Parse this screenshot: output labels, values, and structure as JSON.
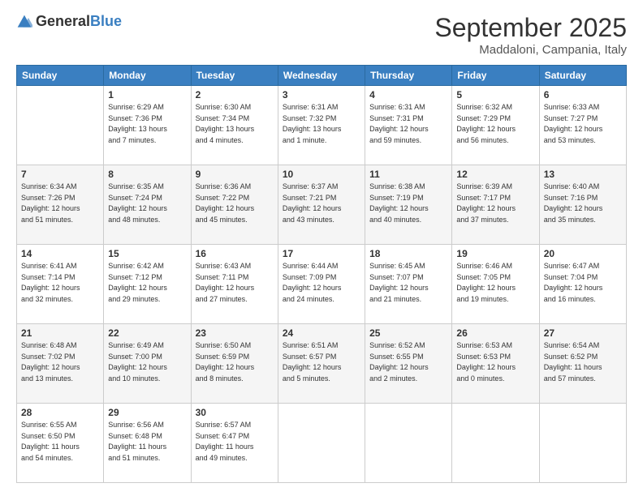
{
  "logo": {
    "general": "General",
    "blue": "Blue"
  },
  "header": {
    "month": "September 2025",
    "location": "Maddaloni, Campania, Italy"
  },
  "weekdays": [
    "Sunday",
    "Monday",
    "Tuesday",
    "Wednesday",
    "Thursday",
    "Friday",
    "Saturday"
  ],
  "weeks": [
    [
      {
        "day": "",
        "info": ""
      },
      {
        "day": "1",
        "info": "Sunrise: 6:29 AM\nSunset: 7:36 PM\nDaylight: 13 hours\nand 7 minutes."
      },
      {
        "day": "2",
        "info": "Sunrise: 6:30 AM\nSunset: 7:34 PM\nDaylight: 13 hours\nand 4 minutes."
      },
      {
        "day": "3",
        "info": "Sunrise: 6:31 AM\nSunset: 7:32 PM\nDaylight: 13 hours\nand 1 minute."
      },
      {
        "day": "4",
        "info": "Sunrise: 6:31 AM\nSunset: 7:31 PM\nDaylight: 12 hours\nand 59 minutes."
      },
      {
        "day": "5",
        "info": "Sunrise: 6:32 AM\nSunset: 7:29 PM\nDaylight: 12 hours\nand 56 minutes."
      },
      {
        "day": "6",
        "info": "Sunrise: 6:33 AM\nSunset: 7:27 PM\nDaylight: 12 hours\nand 53 minutes."
      }
    ],
    [
      {
        "day": "7",
        "info": "Sunrise: 6:34 AM\nSunset: 7:26 PM\nDaylight: 12 hours\nand 51 minutes."
      },
      {
        "day": "8",
        "info": "Sunrise: 6:35 AM\nSunset: 7:24 PM\nDaylight: 12 hours\nand 48 minutes."
      },
      {
        "day": "9",
        "info": "Sunrise: 6:36 AM\nSunset: 7:22 PM\nDaylight: 12 hours\nand 45 minutes."
      },
      {
        "day": "10",
        "info": "Sunrise: 6:37 AM\nSunset: 7:21 PM\nDaylight: 12 hours\nand 43 minutes."
      },
      {
        "day": "11",
        "info": "Sunrise: 6:38 AM\nSunset: 7:19 PM\nDaylight: 12 hours\nand 40 minutes."
      },
      {
        "day": "12",
        "info": "Sunrise: 6:39 AM\nSunset: 7:17 PM\nDaylight: 12 hours\nand 37 minutes."
      },
      {
        "day": "13",
        "info": "Sunrise: 6:40 AM\nSunset: 7:16 PM\nDaylight: 12 hours\nand 35 minutes."
      }
    ],
    [
      {
        "day": "14",
        "info": "Sunrise: 6:41 AM\nSunset: 7:14 PM\nDaylight: 12 hours\nand 32 minutes."
      },
      {
        "day": "15",
        "info": "Sunrise: 6:42 AM\nSunset: 7:12 PM\nDaylight: 12 hours\nand 29 minutes."
      },
      {
        "day": "16",
        "info": "Sunrise: 6:43 AM\nSunset: 7:11 PM\nDaylight: 12 hours\nand 27 minutes."
      },
      {
        "day": "17",
        "info": "Sunrise: 6:44 AM\nSunset: 7:09 PM\nDaylight: 12 hours\nand 24 minutes."
      },
      {
        "day": "18",
        "info": "Sunrise: 6:45 AM\nSunset: 7:07 PM\nDaylight: 12 hours\nand 21 minutes."
      },
      {
        "day": "19",
        "info": "Sunrise: 6:46 AM\nSunset: 7:05 PM\nDaylight: 12 hours\nand 19 minutes."
      },
      {
        "day": "20",
        "info": "Sunrise: 6:47 AM\nSunset: 7:04 PM\nDaylight: 12 hours\nand 16 minutes."
      }
    ],
    [
      {
        "day": "21",
        "info": "Sunrise: 6:48 AM\nSunset: 7:02 PM\nDaylight: 12 hours\nand 13 minutes."
      },
      {
        "day": "22",
        "info": "Sunrise: 6:49 AM\nSunset: 7:00 PM\nDaylight: 12 hours\nand 10 minutes."
      },
      {
        "day": "23",
        "info": "Sunrise: 6:50 AM\nSunset: 6:59 PM\nDaylight: 12 hours\nand 8 minutes."
      },
      {
        "day": "24",
        "info": "Sunrise: 6:51 AM\nSunset: 6:57 PM\nDaylight: 12 hours\nand 5 minutes."
      },
      {
        "day": "25",
        "info": "Sunrise: 6:52 AM\nSunset: 6:55 PM\nDaylight: 12 hours\nand 2 minutes."
      },
      {
        "day": "26",
        "info": "Sunrise: 6:53 AM\nSunset: 6:53 PM\nDaylight: 12 hours\nand 0 minutes."
      },
      {
        "day": "27",
        "info": "Sunrise: 6:54 AM\nSunset: 6:52 PM\nDaylight: 11 hours\nand 57 minutes."
      }
    ],
    [
      {
        "day": "28",
        "info": "Sunrise: 6:55 AM\nSunset: 6:50 PM\nDaylight: 11 hours\nand 54 minutes."
      },
      {
        "day": "29",
        "info": "Sunrise: 6:56 AM\nSunset: 6:48 PM\nDaylight: 11 hours\nand 51 minutes."
      },
      {
        "day": "30",
        "info": "Sunrise: 6:57 AM\nSunset: 6:47 PM\nDaylight: 11 hours\nand 49 minutes."
      },
      {
        "day": "",
        "info": ""
      },
      {
        "day": "",
        "info": ""
      },
      {
        "day": "",
        "info": ""
      },
      {
        "day": "",
        "info": ""
      }
    ]
  ]
}
